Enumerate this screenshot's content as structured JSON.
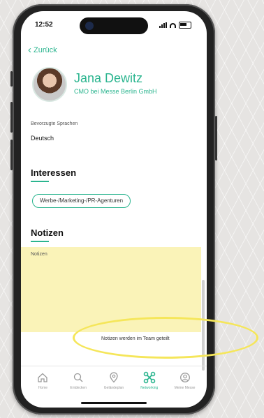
{
  "status": {
    "time": "12:52"
  },
  "nav": {
    "back_label": "Zurück"
  },
  "profile": {
    "name": "Jana Dewitz",
    "role": "CMO bei Messe Berlin GmbH"
  },
  "languages": {
    "label": "Bevorzugte Sprachen",
    "value": "Deutsch"
  },
  "interests": {
    "title": "Interessen",
    "chips": [
      "Werbe-/Marketing-/PR-Agenturen"
    ]
  },
  "notes": {
    "title": "Notizen",
    "placeholder": "Notizen",
    "hint": "Notizen werden im Team geteilt"
  },
  "tabbar": {
    "items": [
      {
        "label": "Home",
        "icon": "home-icon"
      },
      {
        "label": "Entdecken",
        "icon": "search-icon"
      },
      {
        "label": "Geländeplan",
        "icon": "map-pin-icon"
      },
      {
        "label": "Networking",
        "icon": "networking-icon",
        "active": true
      },
      {
        "label": "Meine Messe",
        "icon": "profile-icon"
      }
    ]
  },
  "colors": {
    "accent": "#2bb58f",
    "notes_bg": "#faf3b8",
    "highlight": "#f5e65a"
  }
}
